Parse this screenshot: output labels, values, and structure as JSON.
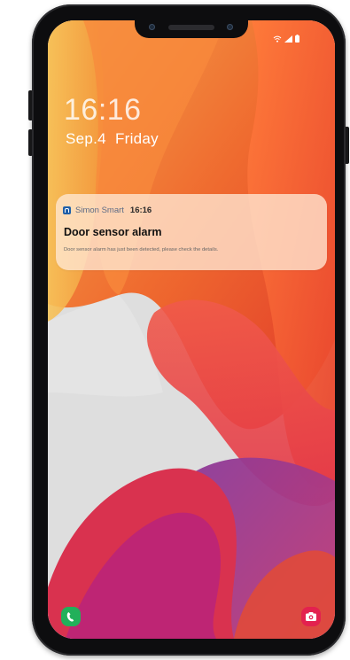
{
  "lock_screen": {
    "time": "16:16",
    "date": "Sep.4",
    "weekday": "Friday"
  },
  "notification": {
    "app_name": "Simon Smart",
    "time": "16:16",
    "title": "Door sensor alarm",
    "body": "Door sensor alarm has just been detected, please check the details."
  },
  "status_bar": {
    "icons": [
      "wifi-icon",
      "signal-icon",
      "battery-icon"
    ]
  },
  "shortcuts": {
    "left": "phone-icon",
    "right": "camera-icon"
  },
  "colors": {
    "phone_shortcut": "#22b05a",
    "camera_shortcut": "#e3214f",
    "app_icon": "#1f5fa8",
    "frame": "#0d0d0f"
  }
}
